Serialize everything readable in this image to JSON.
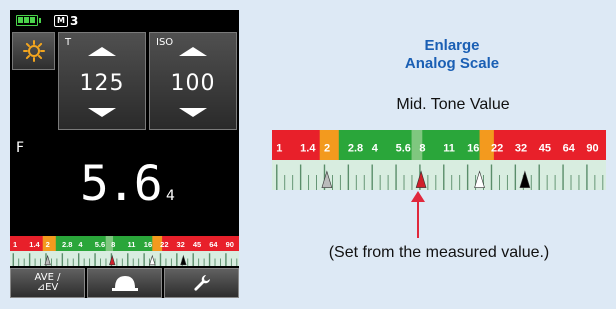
{
  "status": {
    "mode_box": "M",
    "mode_num": "3"
  },
  "tbutton": {
    "label": "T",
    "value": "125"
  },
  "isobutton": {
    "label": "ISO",
    "value": "100"
  },
  "fstop": {
    "label": "F",
    "value": "5.6",
    "sub": "4"
  },
  "bottom_bar": {
    "ave_line1": "AVE /",
    "ave_line2": "⊿EV"
  },
  "annotation": {
    "title_line1": "Enlarge",
    "title_line2": "Analog Scale",
    "midtone": "Mid. Tone Value",
    "note": "(Set from the measured value.)"
  },
  "scale": {
    "labels": [
      "1",
      "1.4",
      "2",
      "2.8",
      "4",
      "5.6",
      "8",
      "11",
      "16",
      "22",
      "32",
      "45",
      "64",
      "90"
    ]
  },
  "colors": {
    "accent": "#1a5fb4",
    "pointer": "#e0283c",
    "scale_red": "#e8202a",
    "scale_orange": "#f39a1e",
    "scale_green": "#2aa63a",
    "battery": "#4bd34b",
    "sun": "#f3a51e"
  },
  "icons": [
    "battery-icon",
    "sun-icon",
    "up-arrow-icon",
    "down-arrow-icon",
    "dome-icon",
    "wrench-icon",
    "pointer-arrow-icon"
  ]
}
